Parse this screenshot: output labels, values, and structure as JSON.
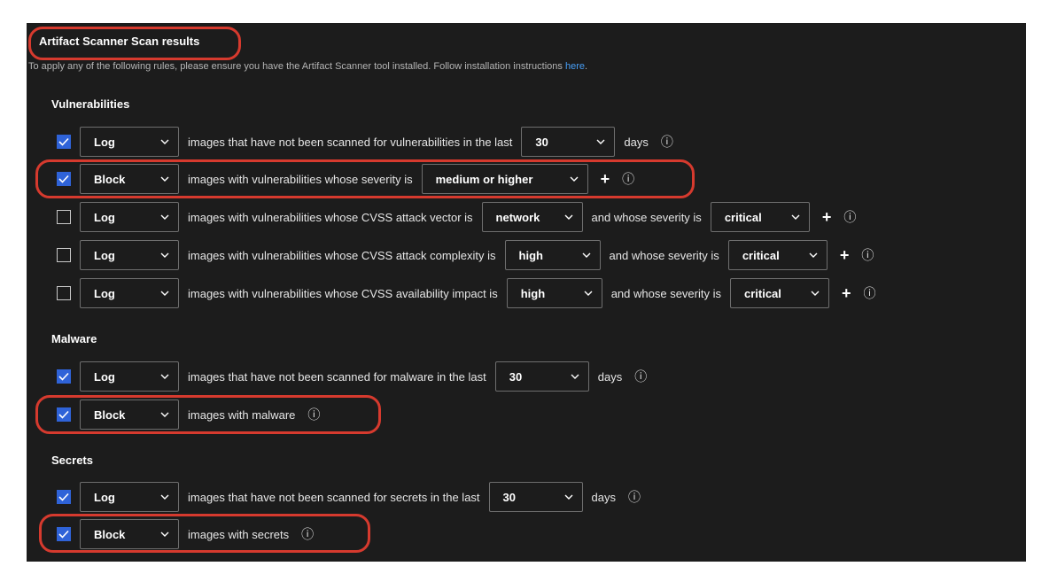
{
  "panel": {
    "title": "Artifact Scanner Scan results",
    "intro_text": "To apply any of the following rules, please ensure you have the Artifact Scanner tool installed. Follow installation instructions ",
    "intro_link": "here",
    "intro_end": "."
  },
  "colors": {
    "panel_bg": "#1c1c1c",
    "checkbox_checked": "#2f63d8",
    "link": "#479ef5",
    "highlight": "#d63a2e"
  },
  "icons": {
    "info": "ⓘ",
    "plus": "+",
    "checkmark": "checkmark-icon",
    "chevron": "chevron-down-icon"
  },
  "vulnerabilities": {
    "heading": "Vulnerabilities",
    "unscanned": {
      "checked": true,
      "action": "Log",
      "text": "images that have not been scanned for vulnerabilities in the last",
      "days_value": "30",
      "days_label": "days"
    },
    "severity": {
      "checked": true,
      "action": "Block",
      "text": "images with vulnerabilities whose severity is",
      "severity_value": "medium or higher"
    },
    "attack_vector": {
      "checked": false,
      "action": "Log",
      "text": "images with vulnerabilities whose CVSS attack vector is",
      "value": "network",
      "and_text": "and whose severity is",
      "severity_value": "critical"
    },
    "attack_complexity": {
      "checked": false,
      "action": "Log",
      "text": "images with vulnerabilities whose CVSS attack complexity is",
      "value": "high",
      "and_text": "and whose severity is",
      "severity_value": "critical"
    },
    "availability_impact": {
      "checked": false,
      "action": "Log",
      "text": "images with vulnerabilities whose CVSS availability impact is",
      "value": "high",
      "and_text": "and whose severity is",
      "severity_value": "critical"
    }
  },
  "malware": {
    "heading": "Malware",
    "unscanned": {
      "checked": true,
      "action": "Log",
      "text": "images that have not been scanned for malware in the last",
      "days_value": "30",
      "days_label": "days"
    },
    "block": {
      "checked": true,
      "action": "Block",
      "text": "images with malware"
    }
  },
  "secrets": {
    "heading": "Secrets",
    "unscanned": {
      "checked": true,
      "action": "Log",
      "text": "images that have not been scanned for secrets in the last",
      "days_value": "30",
      "days_label": "days"
    },
    "block": {
      "checked": true,
      "action": "Block",
      "text": "images with secrets"
    }
  }
}
